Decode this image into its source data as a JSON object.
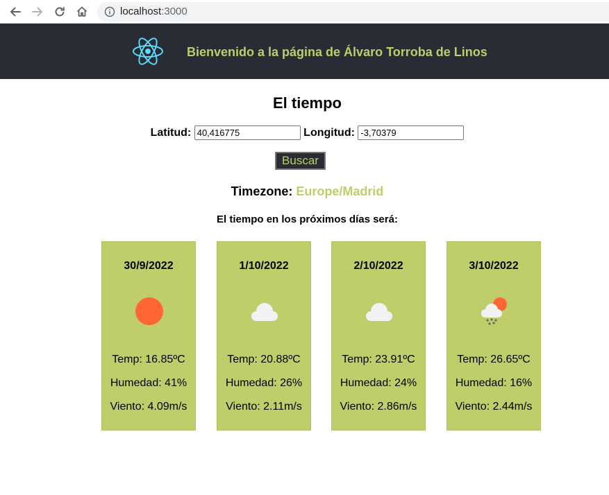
{
  "browser": {
    "url_host": "localhost",
    "url_port": ":3000",
    "icons": [
      "back-arrow-icon",
      "forward-arrow-icon",
      "reload-icon",
      "home-icon",
      "info-icon"
    ]
  },
  "header": {
    "title": "Bienvenido a la página de Álvaro Torroba de Linos",
    "logo_icon": "react-logo-icon",
    "background": "#282c34",
    "accent": "#bfcd6a"
  },
  "main": {
    "title": "El tiempo",
    "latitude_label": "Latitud:",
    "latitude_value": "40,416775",
    "longitude_label": "Longitud:",
    "longitude_value": "-3,70379",
    "search_label": "Buscar",
    "timezone_label": "Timezone:",
    "timezone_value": "Europe/Madrid",
    "forecast_heading": "El tiempo en los próximos días será:"
  },
  "forecast": [
    {
      "date": "30/9/2022",
      "icon": "sun-icon",
      "temp": "Temp: 16.85ºC",
      "humidity": "Humedad: 41%",
      "wind": "Viento: 4.09m/s"
    },
    {
      "date": "1/10/2022",
      "icon": "cloud-icon",
      "temp": "Temp: 20.88ºC",
      "humidity": "Humedad: 26%",
      "wind": "Viento: 2.11m/s"
    },
    {
      "date": "2/10/2022",
      "icon": "cloud-icon",
      "temp": "Temp: 23.91ºC",
      "humidity": "Humedad: 24%",
      "wind": "Viento: 2.86m/s"
    },
    {
      "date": "3/10/2022",
      "icon": "sun-cloud-rain-icon",
      "temp": "Temp: 26.65ºC",
      "humidity": "Humedad: 16%",
      "wind": "Viento: 2.44m/s"
    }
  ],
  "colors": {
    "card_background": "#bfcd6a",
    "sun": "#ff6633",
    "cloud": "#f2f2f2"
  }
}
